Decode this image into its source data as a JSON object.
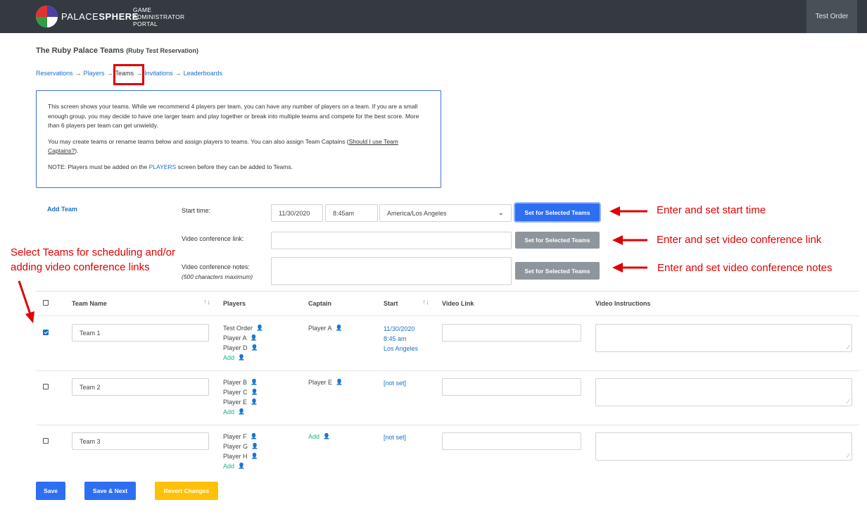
{
  "header": {
    "brand_light": "PALACE",
    "brand_bold": "SPHERE",
    "portal_lines": [
      "GAME",
      "ADMINISTRATOR",
      "PORTAL"
    ],
    "user_menu": "Test Order",
    "logo_colors": [
      "#e03131",
      "#4c3fa6",
      "#2f9e44",
      "#ffffff"
    ]
  },
  "page": {
    "title": "The Ruby Palace Teams",
    "subtitle": "(Ruby Test Reservation)"
  },
  "breadcrumb": {
    "items": [
      "Reservations",
      "Players",
      "Teams",
      "Invitations",
      "Leaderboards"
    ],
    "separator": "→"
  },
  "info": {
    "p1": "This screen shows your teams. While we recommend 4 players per team, you can have any number of players on a team. If you are a small enough group, you may decide to have one larger team and play together or break into multiple teams and compete for the best score. More than 6 players per team can get unwieldy.",
    "p2_before": "You may create teams or rename teams below and assign players to teams. You can also assign Team Captains (",
    "p2_link": "Should I use Team Captains?",
    "p2_after": ").",
    "p3_before": "NOTE: Players must be added on the ",
    "p3_link": "PLAYERS",
    "p3_after": " screen before they can be added to Teams."
  },
  "form": {
    "add_team": "Add Team",
    "start_label": "Start time:",
    "date_value": "11/30/2020",
    "time_value": "8:45am",
    "timezone_value": "America/Los Angeles",
    "video_label": "Video conference link:",
    "video_value": "",
    "notes_label": "Video conference notes:",
    "notes_hint": "(500 characters maximum)",
    "notes_value": "",
    "set_button": "Set for Selected Teams"
  },
  "annotations": {
    "start": "Enter and set start time",
    "video": "Enter and set video conference link",
    "notes": "Enter and set video conference notes",
    "select_line1": "Select Teams for scheduling and/or",
    "select_line2": "adding video conference links",
    "color": "#e00000"
  },
  "table": {
    "headers": [
      "Team Name",
      "Players",
      "Captain",
      "Start",
      "Video Link",
      "Video Instructions"
    ],
    "add_label": "Add",
    "rows": [
      {
        "checked": true,
        "team_name": "Team 1",
        "players": [
          "Test Order",
          "Player A",
          "Player D"
        ],
        "captain": "Player A",
        "start": [
          "11/30/2020",
          "8:45 am",
          "Los Angeles"
        ],
        "video_link": "",
        "video_instructions": ""
      },
      {
        "checked": false,
        "team_name": "Team 2",
        "players": [
          "Player B",
          "Player C",
          "Player E"
        ],
        "captain": "Player E",
        "start": [
          "[not set]"
        ],
        "video_link": "",
        "video_instructions": ""
      },
      {
        "checked": false,
        "team_name": "Team 3",
        "players": [
          "Player F",
          "Player G",
          "Player H"
        ],
        "captain": "",
        "start": [
          "[not set]"
        ],
        "video_link": "",
        "video_instructions": ""
      }
    ]
  },
  "actions": {
    "save": "Save",
    "save_next": "Save & Next",
    "revert": "Revert Changes"
  }
}
